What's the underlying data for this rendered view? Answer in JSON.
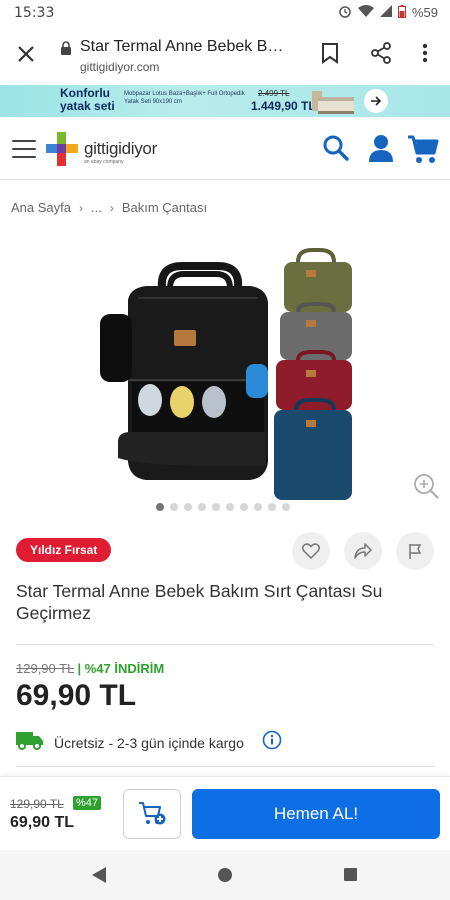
{
  "status_bar": {
    "time": "15:33",
    "battery": "%59"
  },
  "browser": {
    "page_title": "Star Termal Anne Bebek B…",
    "url": "gittigidiyor.com"
  },
  "promo": {
    "title": "Konforlu yatak seti",
    "description": "Mobpazar Lotus Baza+Başlık+ Full Ortopedik Yatak Seti 90x190 cm",
    "old_price": "2.499 TL",
    "new_price": "1.449,90 TL"
  },
  "header": {
    "logo_text": "gittigidiyor",
    "logo_sub": "an ebay company"
  },
  "breadcrumb": {
    "items": [
      "Ana Sayfa",
      "...",
      "Bakım Çantası"
    ]
  },
  "gallery": {
    "dot_count": 10,
    "active_index": 0
  },
  "product": {
    "badge": "Yıldız Fırsat",
    "title": "Star Termal Anne Bebek Bakım Sırt Çantası Su Geçirmez",
    "old_price": "129,90 TL",
    "discount": "| %47 İNDİRİM",
    "price": "69,90 TL",
    "shipping": "Ücretsiz - 2-3 gün içinde kargo"
  },
  "bottom_bar": {
    "old_price": "129,90 TL",
    "discount": "%47",
    "price": "69,90 TL",
    "buy_label": "Hemen AL!"
  },
  "colors": {
    "brand_blue": "#0d6ee6",
    "badge_red": "#e01c32",
    "discount_green": "#2ea12e",
    "promo_bg": "#a8e6e8"
  },
  "icons": [
    "close-icon",
    "lock-icon",
    "bookmark-icon",
    "share-icon",
    "more-vert-icon",
    "menu-icon",
    "search-icon",
    "account-icon",
    "cart-icon",
    "zoom-icon",
    "heart-icon",
    "share-arrow-icon",
    "flag-icon",
    "truck-icon",
    "info-icon",
    "add-to-cart-icon"
  ]
}
